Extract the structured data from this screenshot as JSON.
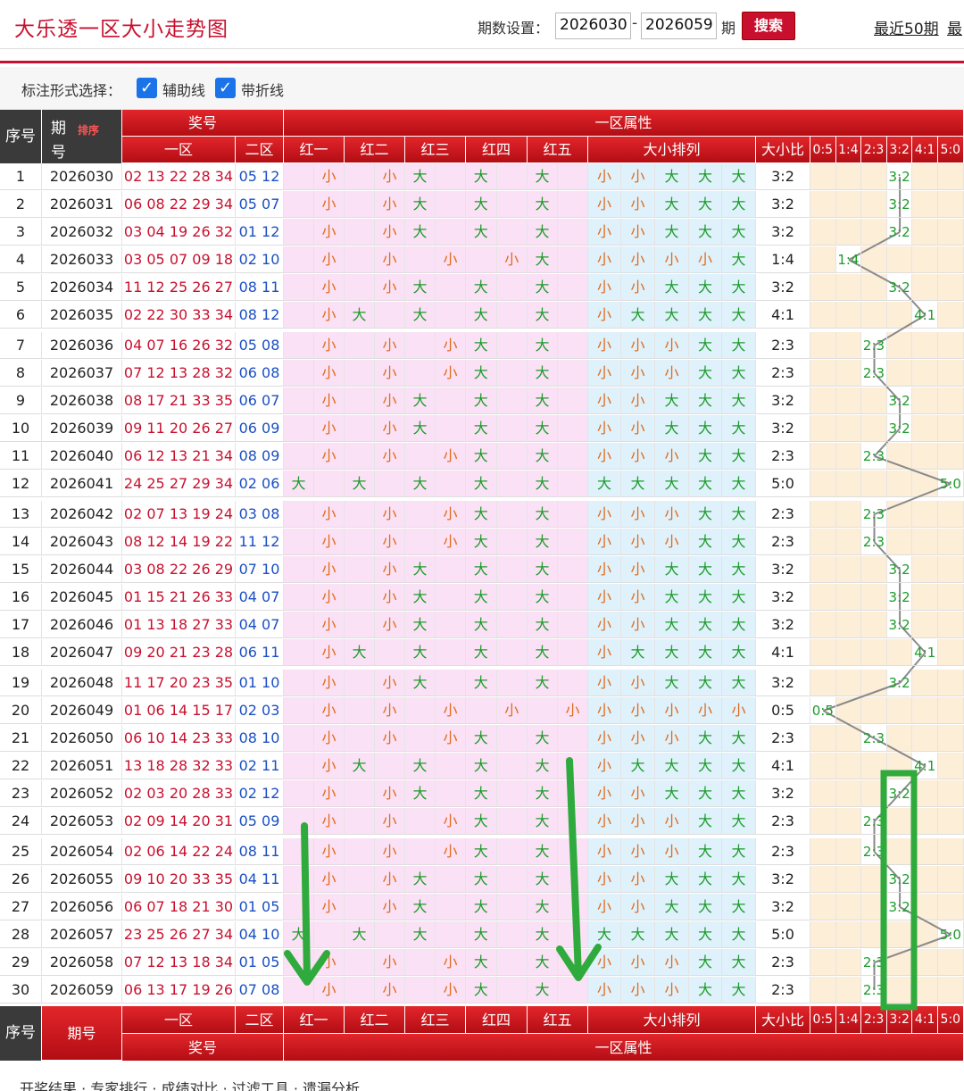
{
  "header": {
    "title": "大乐透一区大小走势图",
    "period_label": "期数设置：",
    "start": "2026030",
    "end": "2026059",
    "dash": "-",
    "qi": "期",
    "search": "搜索",
    "recent50": "最近50期",
    "recent_more": "最"
  },
  "options": {
    "label": "标注形式选择：",
    "opt1": "辅助线",
    "opt2": "带折线"
  },
  "columns": {
    "seq": "序号",
    "period_top": "期",
    "period_bottom": "号",
    "sort": "排序",
    "prize": "奖号",
    "zone1": "一区",
    "zone2": "二区",
    "attr": "一区属性",
    "reds": [
      "红一",
      "红二",
      "红三",
      "红四",
      "红五"
    ],
    "sizeseq": "大小排列",
    "ratio": "大小比",
    "ratio_labels": [
      "0:5",
      "1:4",
      "2:3",
      "3:2",
      "4:1",
      "5:0"
    ],
    "footer_period": "期号"
  },
  "footer_text": "开奖结果 · 专家排行 · 成绩对比 · 过滤工具 · 遗漏分析",
  "rows": [
    {
      "seq": "1",
      "period": "2026030",
      "z1": "02 13 22 28 34",
      "z2": "05 12",
      "sizes": [
        "小",
        "小",
        "大",
        "大",
        "大"
      ],
      "ratio": "3:2"
    },
    {
      "seq": "2",
      "period": "2026031",
      "z1": "06 08 22 29 34",
      "z2": "05 07",
      "sizes": [
        "小",
        "小",
        "大",
        "大",
        "大"
      ],
      "ratio": "3:2"
    },
    {
      "seq": "3",
      "period": "2026032",
      "z1": "03 04 19 26 32",
      "z2": "01 12",
      "sizes": [
        "小",
        "小",
        "大",
        "大",
        "大"
      ],
      "ratio": "3:2"
    },
    {
      "seq": "4",
      "period": "2026033",
      "z1": "03 05 07 09 18",
      "z2": "02 10",
      "sizes": [
        "小",
        "小",
        "小",
        "小",
        "大"
      ],
      "ratio": "1:4"
    },
    {
      "seq": "5",
      "period": "2026034",
      "z1": "11 12 25 26 27",
      "z2": "08 11",
      "sizes": [
        "小",
        "小",
        "大",
        "大",
        "大"
      ],
      "ratio": "3:2"
    },
    {
      "seq": "6",
      "period": "2026035",
      "z1": "02 22 30 33 34",
      "z2": "08 12",
      "sizes": [
        "小",
        "大",
        "大",
        "大",
        "大"
      ],
      "ratio": "4:1"
    },
    {
      "seq": "7",
      "period": "2026036",
      "z1": "04 07 16 26 32",
      "z2": "05 08",
      "sizes": [
        "小",
        "小",
        "小",
        "大",
        "大"
      ],
      "ratio": "2:3"
    },
    {
      "seq": "8",
      "period": "2026037",
      "z1": "07 12 13 28 32",
      "z2": "06 08",
      "sizes": [
        "小",
        "小",
        "小",
        "大",
        "大"
      ],
      "ratio": "2:3"
    },
    {
      "seq": "9",
      "period": "2026038",
      "z1": "08 17 21 33 35",
      "z2": "06 07",
      "sizes": [
        "小",
        "小",
        "大",
        "大",
        "大"
      ],
      "ratio": "3:2"
    },
    {
      "seq": "10",
      "period": "2026039",
      "z1": "09 11 20 26 27",
      "z2": "06 09",
      "sizes": [
        "小",
        "小",
        "大",
        "大",
        "大"
      ],
      "ratio": "3:2"
    },
    {
      "seq": "11",
      "period": "2026040",
      "z1": "06 12 13 21 34",
      "z2": "08 09",
      "sizes": [
        "小",
        "小",
        "小",
        "大",
        "大"
      ],
      "ratio": "2:3"
    },
    {
      "seq": "12",
      "period": "2026041",
      "z1": "24 25 27 29 34",
      "z2": "02 06",
      "sizes": [
        "大",
        "大",
        "大",
        "大",
        "大"
      ],
      "ratio": "5:0"
    },
    {
      "seq": "13",
      "period": "2026042",
      "z1": "02 07 13 19 24",
      "z2": "03 08",
      "sizes": [
        "小",
        "小",
        "小",
        "大",
        "大"
      ],
      "ratio": "2:3"
    },
    {
      "seq": "14",
      "period": "2026043",
      "z1": "08 12 14 19 22",
      "z2": "11 12",
      "sizes": [
        "小",
        "小",
        "小",
        "大",
        "大"
      ],
      "ratio": "2:3"
    },
    {
      "seq": "15",
      "period": "2026044",
      "z1": "03 08 22 26 29",
      "z2": "07 10",
      "sizes": [
        "小",
        "小",
        "大",
        "大",
        "大"
      ],
      "ratio": "3:2"
    },
    {
      "seq": "16",
      "period": "2026045",
      "z1": "01 15 21 26 33",
      "z2": "04 07",
      "sizes": [
        "小",
        "小",
        "大",
        "大",
        "大"
      ],
      "ratio": "3:2"
    },
    {
      "seq": "17",
      "period": "2026046",
      "z1": "01 13 18 27 33",
      "z2": "04 07",
      "sizes": [
        "小",
        "小",
        "大",
        "大",
        "大"
      ],
      "ratio": "3:2"
    },
    {
      "seq": "18",
      "period": "2026047",
      "z1": "09 20 21 23 28",
      "z2": "06 11",
      "sizes": [
        "小",
        "大",
        "大",
        "大",
        "大"
      ],
      "ratio": "4:1"
    },
    {
      "seq": "19",
      "period": "2026048",
      "z1": "11 17 20 23 35",
      "z2": "01 10",
      "sizes": [
        "小",
        "小",
        "大",
        "大",
        "大"
      ],
      "ratio": "3:2"
    },
    {
      "seq": "20",
      "period": "2026049",
      "z1": "01 06 14 15 17",
      "z2": "02 03",
      "sizes": [
        "小",
        "小",
        "小",
        "小",
        "小"
      ],
      "ratio": "0:5"
    },
    {
      "seq": "21",
      "period": "2026050",
      "z1": "06 10 14 23 33",
      "z2": "08 10",
      "sizes": [
        "小",
        "小",
        "小",
        "大",
        "大"
      ],
      "ratio": "2:3"
    },
    {
      "seq": "22",
      "period": "2026051",
      "z1": "13 18 28 32 33",
      "z2": "02 11",
      "sizes": [
        "小",
        "大",
        "大",
        "大",
        "大"
      ],
      "ratio": "4:1"
    },
    {
      "seq": "23",
      "period": "2026052",
      "z1": "02 03 20 28 33",
      "z2": "02 12",
      "sizes": [
        "小",
        "小",
        "大",
        "大",
        "大"
      ],
      "ratio": "3:2"
    },
    {
      "seq": "24",
      "period": "2026053",
      "z1": "02 09 14 20 31",
      "z2": "05 09",
      "sizes": [
        "小",
        "小",
        "小",
        "大",
        "大"
      ],
      "ratio": "2:3"
    },
    {
      "seq": "25",
      "period": "2026054",
      "z1": "02 06 14 22 24",
      "z2": "08 11",
      "sizes": [
        "小",
        "小",
        "小",
        "大",
        "大"
      ],
      "ratio": "2:3"
    },
    {
      "seq": "26",
      "period": "2026055",
      "z1": "09 10 20 33 35",
      "z2": "04 11",
      "sizes": [
        "小",
        "小",
        "大",
        "大",
        "大"
      ],
      "ratio": "3:2"
    },
    {
      "seq": "27",
      "period": "2026056",
      "z1": "06 07 18 21 30",
      "z2": "01 05",
      "sizes": [
        "小",
        "小",
        "大",
        "大",
        "大"
      ],
      "ratio": "3:2"
    },
    {
      "seq": "28",
      "period": "2026057",
      "z1": "23 25 26 27 34",
      "z2": "04 10",
      "sizes": [
        "大",
        "大",
        "大",
        "大",
        "大"
      ],
      "ratio": "5:0"
    },
    {
      "seq": "29",
      "period": "2026058",
      "z1": "07 12 13 18 34",
      "z2": "01 05",
      "sizes": [
        "小",
        "小",
        "小",
        "大",
        "大"
      ],
      "ratio": "2:3"
    },
    {
      "seq": "30",
      "period": "2026059",
      "z1": "06 13 17 19 26",
      "z2": "07 08",
      "sizes": [
        "小",
        "小",
        "小",
        "大",
        "大"
      ],
      "ratio": "2:3"
    }
  ],
  "colors": {
    "red": "#c8102e",
    "pink": "#fbe1f5",
    "blue": "#dff1fb",
    "cream": "#fdeed8",
    "big": "#1c9c2a",
    "small": "#e06a1a",
    "annotation": "#2faa3c"
  }
}
